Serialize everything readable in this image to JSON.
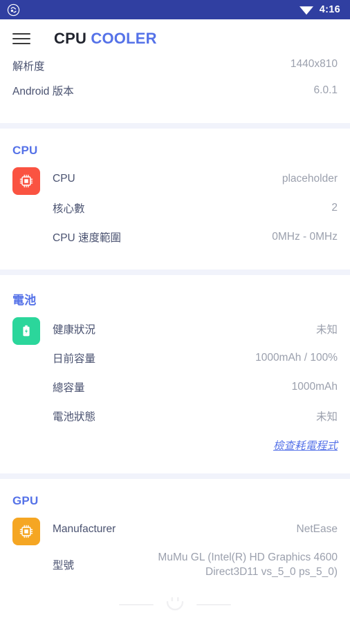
{
  "status_bar": {
    "app_icon": "app-badge-icon",
    "wifi_icon": "wifi-icon",
    "time": "4:16",
    "background_color": "#303fa1"
  },
  "app_bar": {
    "menu_icon": "hamburger-menu-icon",
    "title_primary": "CPU",
    "title_secondary": "COOLER",
    "accent_color": "#5572e8"
  },
  "device_section": {
    "rows": [
      {
        "label": "解析度",
        "value": "1440x810"
      },
      {
        "label": "Android 版本",
        "value": "6.0.1"
      }
    ]
  },
  "cpu_section": {
    "title": "CPU",
    "icon": "cpu-chip-icon",
    "icon_color": "#fa5341",
    "rows": [
      {
        "label": "CPU",
        "value": "placeholder"
      },
      {
        "label": "核心數",
        "value": "2"
      },
      {
        "label": "CPU 速度範圍",
        "value": "0MHz - 0MHz"
      }
    ]
  },
  "battery_section": {
    "title": "電池",
    "icon": "battery-bolt-icon",
    "icon_color": "#2bd69b",
    "rows": [
      {
        "label": "健康狀況",
        "value": "未知"
      },
      {
        "label": "日前容量",
        "value": "1000mAh / 100%"
      },
      {
        "label": "總容量",
        "value": "1000mAh"
      },
      {
        "label": "電池狀態",
        "value": "未知"
      }
    ],
    "link_label": "檢查耗電程式"
  },
  "gpu_section": {
    "title": "GPU",
    "icon": "gpu-chip-icon",
    "icon_color": "#f5a623",
    "rows": [
      {
        "label": "Manufacturer",
        "value": "NetEase"
      },
      {
        "label": "型號",
        "value": "MuMu GL (Intel(R) HD Graphics 4600 Direct3D11 vs_5_0 ps_5_0)"
      }
    ]
  },
  "footer": {
    "icon": "smiley-face-icon"
  }
}
